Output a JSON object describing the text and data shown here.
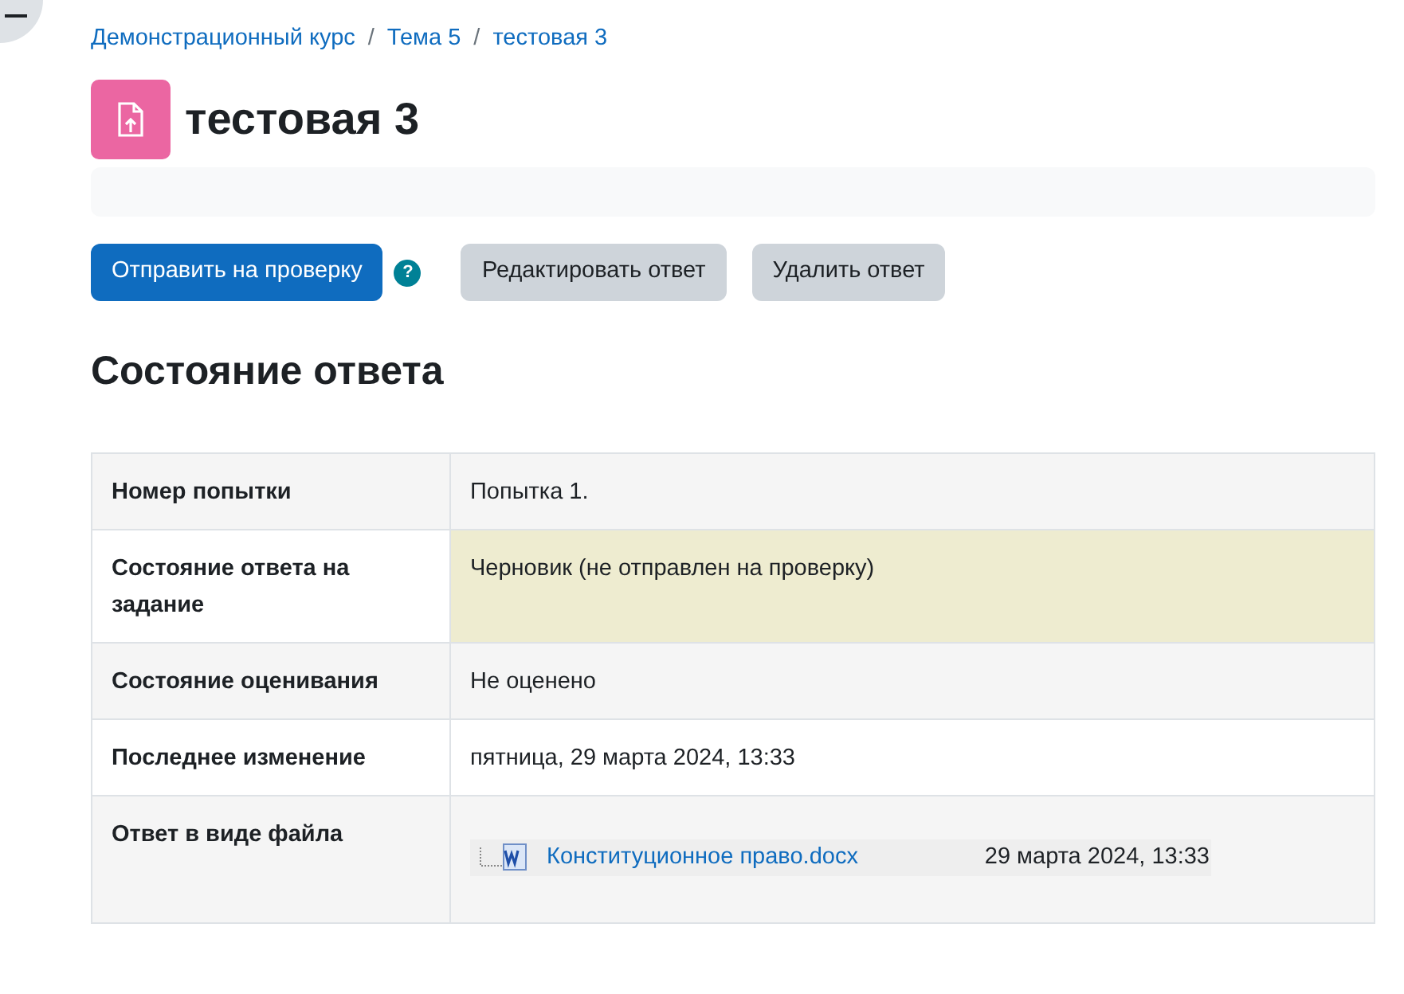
{
  "breadcrumb": [
    "Демонстрационный курс",
    "Тема 5",
    "тестовая 3"
  ],
  "breadcrumb_separators": [
    "/",
    "/"
  ],
  "title": "тестовая 3",
  "buttons": [
    {
      "label": "Отправить на проверку",
      "kind": "primary"
    },
    {
      "label": "Редактировать ответ",
      "kind": "secondary"
    },
    {
      "label": "Удалить ответ",
      "kind": "secondary"
    }
  ],
  "help_icon": "?",
  "section_title": "Состояние ответа",
  "table": {
    "rows": [
      {
        "label": "Номер попытки",
        "value": "Попытка 1.",
        "highlighted": false
      },
      {
        "label": "Состояние ответа на задание",
        "value": "Черновик (не отправлен на проверку)",
        "highlighted": true
      },
      {
        "label": "Состояние оценивания",
        "value": "Не оценено",
        "highlighted": false
      },
      {
        "label": "Последнее изменение",
        "value": "пятница, 29 марта 2024, 13:33",
        "highlighted": false
      },
      {
        "label": "Ответ в виде файла",
        "kind": "file",
        "file": {
          "name": "Конституционное право.docx",
          "date": "29 марта 2024, 13:33"
        },
        "highlighted": false
      }
    ]
  }
}
